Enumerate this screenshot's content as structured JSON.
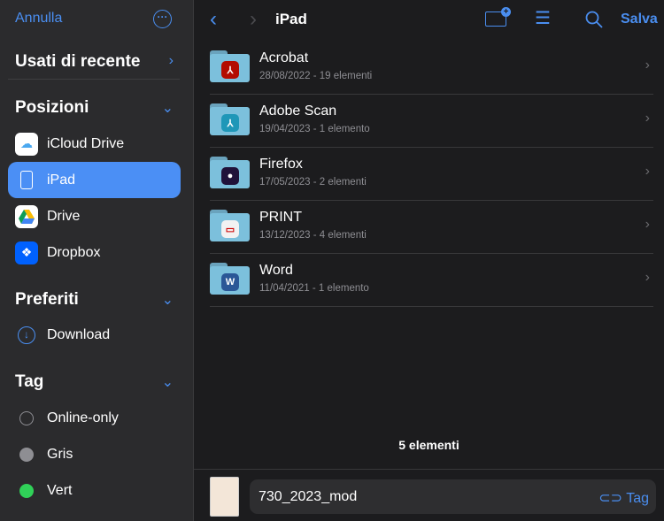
{
  "sidebar": {
    "cancel": "Annulla",
    "recent": "Usati di recente",
    "locations_title": "Posizioni",
    "locations": [
      {
        "label": "iCloud Drive",
        "icon": "icloud-icon"
      },
      {
        "label": "iPad",
        "icon": "ipad-icon",
        "selected": true
      },
      {
        "label": "Drive",
        "icon": "google-drive-icon"
      },
      {
        "label": "Dropbox",
        "icon": "dropbox-icon"
      }
    ],
    "favorites_title": "Preferiti",
    "favorites": [
      {
        "label": "Download",
        "icon": "download-icon"
      }
    ],
    "tags_title": "Tag",
    "tags": [
      {
        "label": "Online-only",
        "color": "transparent"
      },
      {
        "label": "Gris",
        "color": "#8e8e93"
      },
      {
        "label": "Vert",
        "color": "#30d158"
      }
    ]
  },
  "header": {
    "title": "iPad",
    "save": "Salva"
  },
  "folders": [
    {
      "name": "Acrobat",
      "meta": "28/08/2022 - 19 elementi",
      "app_color": "#b30b00"
    },
    {
      "name": "Adobe Scan",
      "meta": "19/04/2023 - 1 elemento",
      "app_color": "#1f97b8"
    },
    {
      "name": "Firefox",
      "meta": "17/05/2023 - 2 elementi",
      "app_color": "#20123a"
    },
    {
      "name": "PRINT",
      "meta": "13/12/2023 - 4 elementi",
      "app_color": "#f2f2f2"
    },
    {
      "name": "Word",
      "meta": "11/04/2021 - 1 elemento",
      "app_color": "#2b5797"
    }
  ],
  "footer": {
    "count": "5 elementi",
    "filename": "730_2023_mod",
    "tag": "Tag"
  }
}
